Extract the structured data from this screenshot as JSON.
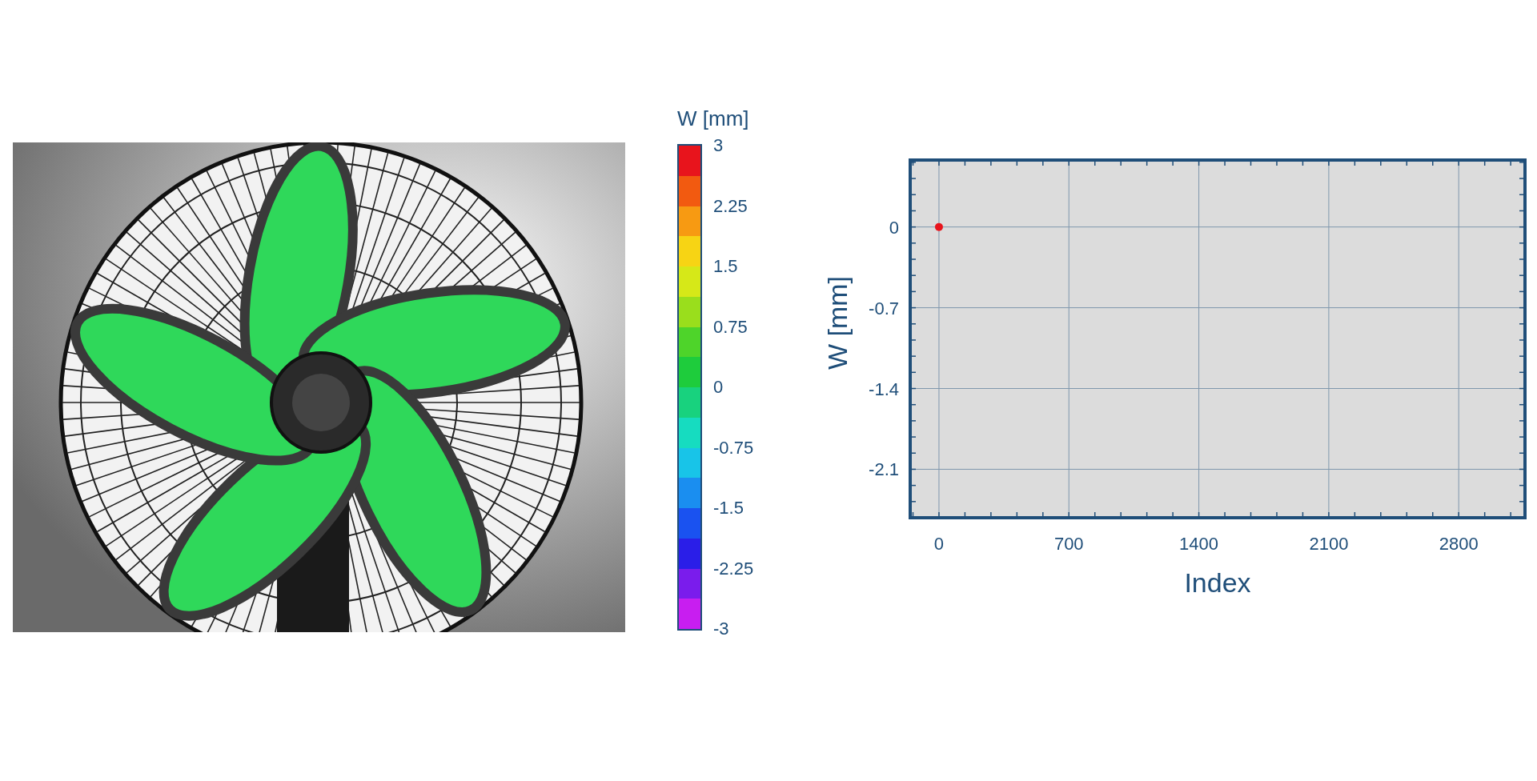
{
  "photo": {
    "kind": "fan"
  },
  "colorbar": {
    "title": "W [mm]",
    "labels": [
      "3",
      "2.25",
      "1.5",
      "0.75",
      "0",
      "-0.75",
      "-1.5",
      "-2.25",
      "-3"
    ],
    "segments": [
      {
        "color": "#e8141c"
      },
      {
        "color": "#f25a10"
      },
      {
        "color": "#f79a12"
      },
      {
        "color": "#f7d414"
      },
      {
        "color": "#d6e818"
      },
      {
        "color": "#9ade1c"
      },
      {
        "color": "#4ed42a"
      },
      {
        "color": "#1ecc3c"
      },
      {
        "color": "#18d27e"
      },
      {
        "color": "#16dcc0"
      },
      {
        "color": "#18c4e8"
      },
      {
        "color": "#1a8ef0"
      },
      {
        "color": "#1a52f0"
      },
      {
        "color": "#2a1ee8"
      },
      {
        "color": "#7a1cec"
      },
      {
        "color": "#c81ef0"
      }
    ]
  },
  "chart": {
    "chart_data": {
      "type": "scatter",
      "xlabel": "Index",
      "ylabel": "W [mm]",
      "x": [
        0
      ],
      "series": [
        {
          "color": "#e8141c",
          "values": [
            0
          ]
        }
      ],
      "xlim": [
        -155,
        3157
      ],
      "ylim": [
        -2.52,
        0.58
      ],
      "xticks": [
        0,
        700,
        1400,
        2100,
        2800
      ],
      "yticks": [
        0,
        -0.7,
        -1.4,
        -2.1
      ],
      "grid": true
    }
  }
}
